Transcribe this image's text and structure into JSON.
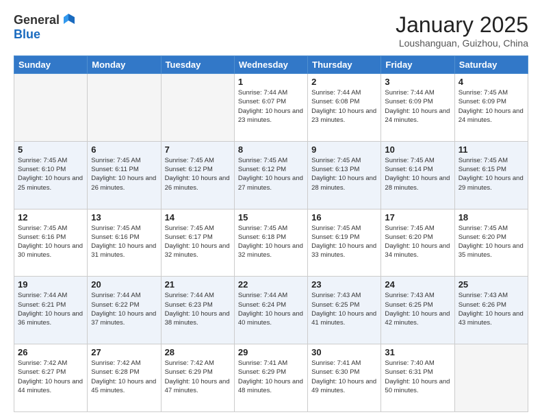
{
  "logo": {
    "general": "General",
    "blue": "Blue"
  },
  "title": "January 2025",
  "subtitle": "Loushanguan, Guizhou, China",
  "weekdays": [
    "Sunday",
    "Monday",
    "Tuesday",
    "Wednesday",
    "Thursday",
    "Friday",
    "Saturday"
  ],
  "weeks": [
    [
      {
        "day": "",
        "info": ""
      },
      {
        "day": "",
        "info": ""
      },
      {
        "day": "",
        "info": ""
      },
      {
        "day": "1",
        "info": "Sunrise: 7:44 AM\nSunset: 6:07 PM\nDaylight: 10 hours\nand 23 minutes."
      },
      {
        "day": "2",
        "info": "Sunrise: 7:44 AM\nSunset: 6:08 PM\nDaylight: 10 hours\nand 23 minutes."
      },
      {
        "day": "3",
        "info": "Sunrise: 7:44 AM\nSunset: 6:09 PM\nDaylight: 10 hours\nand 24 minutes."
      },
      {
        "day": "4",
        "info": "Sunrise: 7:45 AM\nSunset: 6:09 PM\nDaylight: 10 hours\nand 24 minutes."
      }
    ],
    [
      {
        "day": "5",
        "info": "Sunrise: 7:45 AM\nSunset: 6:10 PM\nDaylight: 10 hours\nand 25 minutes."
      },
      {
        "day": "6",
        "info": "Sunrise: 7:45 AM\nSunset: 6:11 PM\nDaylight: 10 hours\nand 26 minutes."
      },
      {
        "day": "7",
        "info": "Sunrise: 7:45 AM\nSunset: 6:12 PM\nDaylight: 10 hours\nand 26 minutes."
      },
      {
        "day": "8",
        "info": "Sunrise: 7:45 AM\nSunset: 6:12 PM\nDaylight: 10 hours\nand 27 minutes."
      },
      {
        "day": "9",
        "info": "Sunrise: 7:45 AM\nSunset: 6:13 PM\nDaylight: 10 hours\nand 28 minutes."
      },
      {
        "day": "10",
        "info": "Sunrise: 7:45 AM\nSunset: 6:14 PM\nDaylight: 10 hours\nand 28 minutes."
      },
      {
        "day": "11",
        "info": "Sunrise: 7:45 AM\nSunset: 6:15 PM\nDaylight: 10 hours\nand 29 minutes."
      }
    ],
    [
      {
        "day": "12",
        "info": "Sunrise: 7:45 AM\nSunset: 6:16 PM\nDaylight: 10 hours\nand 30 minutes."
      },
      {
        "day": "13",
        "info": "Sunrise: 7:45 AM\nSunset: 6:16 PM\nDaylight: 10 hours\nand 31 minutes."
      },
      {
        "day": "14",
        "info": "Sunrise: 7:45 AM\nSunset: 6:17 PM\nDaylight: 10 hours\nand 32 minutes."
      },
      {
        "day": "15",
        "info": "Sunrise: 7:45 AM\nSunset: 6:18 PM\nDaylight: 10 hours\nand 32 minutes."
      },
      {
        "day": "16",
        "info": "Sunrise: 7:45 AM\nSunset: 6:19 PM\nDaylight: 10 hours\nand 33 minutes."
      },
      {
        "day": "17",
        "info": "Sunrise: 7:45 AM\nSunset: 6:20 PM\nDaylight: 10 hours\nand 34 minutes."
      },
      {
        "day": "18",
        "info": "Sunrise: 7:45 AM\nSunset: 6:20 PM\nDaylight: 10 hours\nand 35 minutes."
      }
    ],
    [
      {
        "day": "19",
        "info": "Sunrise: 7:44 AM\nSunset: 6:21 PM\nDaylight: 10 hours\nand 36 minutes."
      },
      {
        "day": "20",
        "info": "Sunrise: 7:44 AM\nSunset: 6:22 PM\nDaylight: 10 hours\nand 37 minutes."
      },
      {
        "day": "21",
        "info": "Sunrise: 7:44 AM\nSunset: 6:23 PM\nDaylight: 10 hours\nand 38 minutes."
      },
      {
        "day": "22",
        "info": "Sunrise: 7:44 AM\nSunset: 6:24 PM\nDaylight: 10 hours\nand 40 minutes."
      },
      {
        "day": "23",
        "info": "Sunrise: 7:43 AM\nSunset: 6:25 PM\nDaylight: 10 hours\nand 41 minutes."
      },
      {
        "day": "24",
        "info": "Sunrise: 7:43 AM\nSunset: 6:25 PM\nDaylight: 10 hours\nand 42 minutes."
      },
      {
        "day": "25",
        "info": "Sunrise: 7:43 AM\nSunset: 6:26 PM\nDaylight: 10 hours\nand 43 minutes."
      }
    ],
    [
      {
        "day": "26",
        "info": "Sunrise: 7:42 AM\nSunset: 6:27 PM\nDaylight: 10 hours\nand 44 minutes."
      },
      {
        "day": "27",
        "info": "Sunrise: 7:42 AM\nSunset: 6:28 PM\nDaylight: 10 hours\nand 45 minutes."
      },
      {
        "day": "28",
        "info": "Sunrise: 7:42 AM\nSunset: 6:29 PM\nDaylight: 10 hours\nand 47 minutes."
      },
      {
        "day": "29",
        "info": "Sunrise: 7:41 AM\nSunset: 6:29 PM\nDaylight: 10 hours\nand 48 minutes."
      },
      {
        "day": "30",
        "info": "Sunrise: 7:41 AM\nSunset: 6:30 PM\nDaylight: 10 hours\nand 49 minutes."
      },
      {
        "day": "31",
        "info": "Sunrise: 7:40 AM\nSunset: 6:31 PM\nDaylight: 10 hours\nand 50 minutes."
      },
      {
        "day": "",
        "info": ""
      }
    ]
  ]
}
